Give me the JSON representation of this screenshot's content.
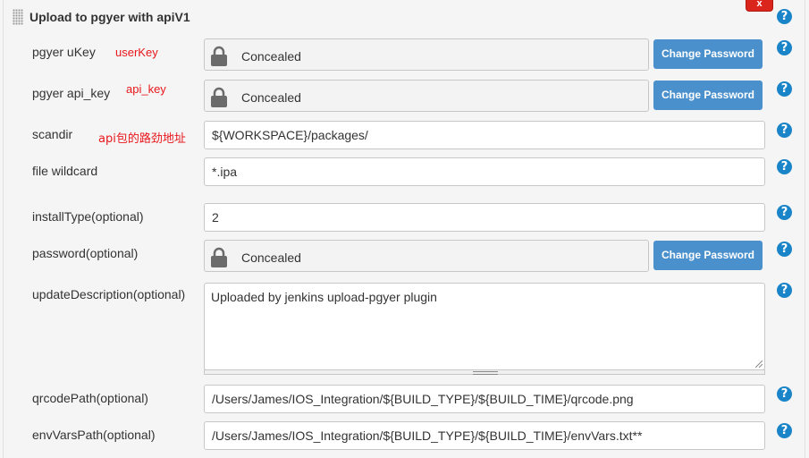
{
  "section": {
    "title": "Upload to pgyer with apiV1",
    "delete_label": "x",
    "help_label": "?"
  },
  "fields": {
    "ukey": {
      "label": "pgyer uKey",
      "annotation": "userKey",
      "value": "Concealed",
      "button": "Change Password"
    },
    "api_key": {
      "label": "pgyer api_key",
      "annotation": "api_key",
      "value": "Concealed",
      "button": "Change Password"
    },
    "scandir": {
      "label": "scandir",
      "annotation": "api包的路劲地址",
      "value": "${WORKSPACE}/packages/"
    },
    "wildcard": {
      "label": "file wildcard",
      "value": "*.ipa"
    },
    "install_type": {
      "label": "installType(optional)",
      "value": "2"
    },
    "password": {
      "label": "password(optional)",
      "value": "Concealed",
      "button": "Change Password"
    },
    "update_description": {
      "label": "updateDescription(optional)",
      "value": "Uploaded by jenkins upload-pgyer plugin"
    },
    "qrcode_path": {
      "label": "qrcodePath(optional)",
      "value": "/Users/James/IOS_Integration/${BUILD_TYPE}/${BUILD_TIME}/qrcode.png"
    },
    "env_vars_path": {
      "label": "envVarsPath(optional)",
      "value": "/Users/James/IOS_Integration/${BUILD_TYPE}/${BUILD_TIME}/envVars.txt**"
    }
  },
  "colors": {
    "accent": "#4a90cc",
    "help": "#1a84c8",
    "delete": "#d9251c",
    "annotation": "#e8161b"
  },
  "icons": [
    "drag-handle-icon",
    "lock-icon",
    "help-icon",
    "resize-grip-icon"
  ]
}
